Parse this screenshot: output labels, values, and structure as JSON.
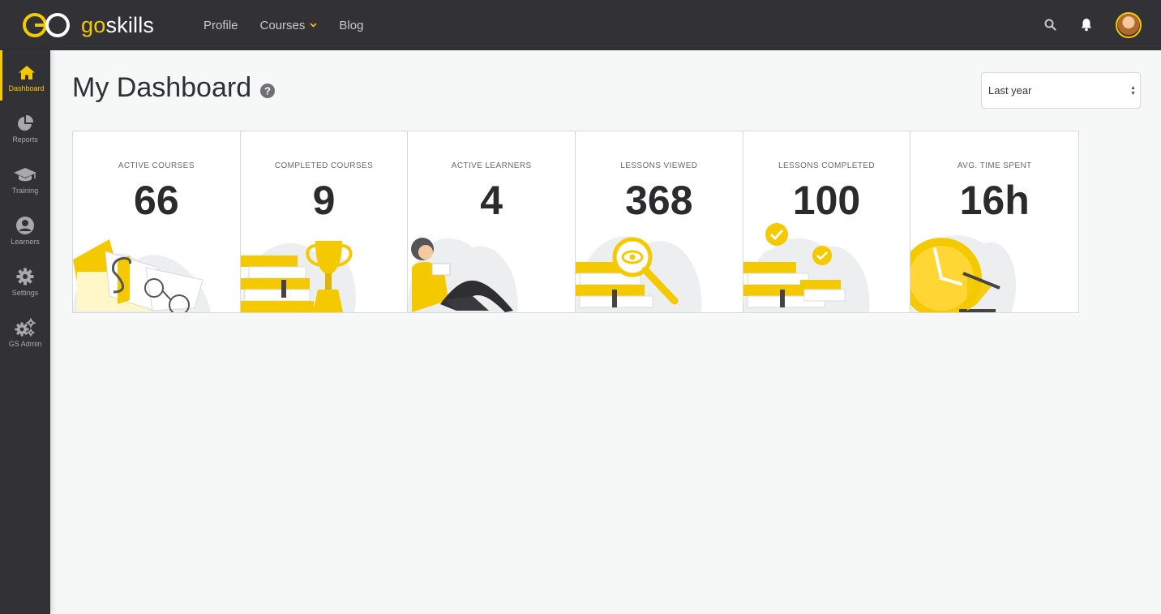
{
  "brand": {
    "go": "go",
    "skills": "skills",
    "accent": "#f5c900"
  },
  "nav": {
    "items": [
      {
        "label": "Profile"
      },
      {
        "label": "Courses"
      },
      {
        "label": "Blog"
      }
    ]
  },
  "sidebar": {
    "items": [
      {
        "label": "Dashboard",
        "icon": "home-icon",
        "active": true
      },
      {
        "label": "Reports",
        "icon": "pie-chart-icon"
      },
      {
        "label": "Training",
        "icon": "graduation-cap-icon"
      },
      {
        "label": "Learners",
        "icon": "user-icon"
      },
      {
        "label": "Settings",
        "icon": "gear-icon"
      },
      {
        "label": "GS Admin",
        "icon": "gears-icon"
      }
    ]
  },
  "page": {
    "title": "My Dashboard"
  },
  "period_select": {
    "value": "Last year"
  },
  "stats": [
    {
      "label": "Active courses",
      "value": "66"
    },
    {
      "label": "Completed courses",
      "value": "9"
    },
    {
      "label": "Active learners",
      "value": "4"
    },
    {
      "label": "Lessons viewed",
      "value": "368"
    },
    {
      "label": "Lessons completed",
      "value": "100"
    },
    {
      "label": "Avg. time spent",
      "value": "16h"
    }
  ]
}
